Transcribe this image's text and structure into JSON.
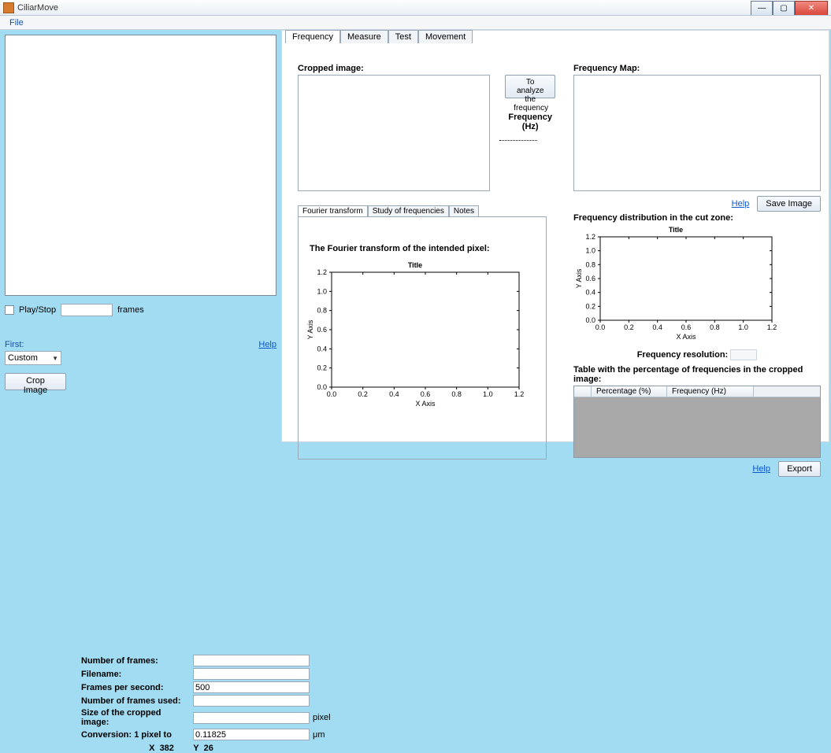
{
  "window": {
    "title": "CiliarMove"
  },
  "menu": {
    "file": "File"
  },
  "winbtns": {
    "min": "—",
    "max": "▢",
    "close": "✕"
  },
  "left": {
    "play_stop": "Play/Stop",
    "frames_suffix": "frames",
    "first_label": "First:",
    "help": "Help",
    "combo_value": "Custom",
    "crop_button": "Crop Image",
    "form": {
      "num_frames_label": "Number of frames:",
      "filename_label": "Filename:",
      "fps_label": "Frames per second:",
      "fps_value": "500",
      "frames_used_label": "Number of frames used:",
      "crop_size_label": "Size of the cropped image:",
      "crop_size_unit": "pixel",
      "conversion_label": "Conversion:   1 pixel to",
      "conversion_value": "0.11825",
      "conversion_unit": "μm"
    },
    "cursor": {
      "x_label": "X",
      "x_val": "382",
      "y_label": "Y",
      "y_val": "26"
    }
  },
  "tabs": {
    "frequency": "Frequency",
    "measure": "Measure",
    "test": "Test",
    "movement": "Movement"
  },
  "freq_tab": {
    "cropped_label": "Cropped image:",
    "analyze_btn": "To analyze the frequency",
    "freq_hz_label": "Frequency (Hz)",
    "fmap_label": "Frequency Map:",
    "save_image": "Save Image",
    "dist_label": "Frequency distribution in the cut zone:",
    "freq_res_label": "Frequency resolution:",
    "table_label": "Table with the percentage of frequencies in the cropped image:",
    "table_cols": {
      "pct": "Percentage (%)",
      "hz": "Frequency (Hz)"
    },
    "export": "Export",
    "help": "Help"
  },
  "sub_tabs": {
    "fourier": "Fourier transform",
    "study": "Study of frequencies",
    "notes": "Notes"
  },
  "fourier": {
    "heading": "The Fourier transform of the intended pixel:"
  },
  "chart_data": [
    {
      "id": "fourier_chart",
      "type": "line",
      "title": "Title",
      "xlabel": "X Axis",
      "ylabel": "Y Axis",
      "xlim": [
        0.0,
        1.2
      ],
      "ylim": [
        0.0,
        1.2
      ],
      "xticks": [
        0.0,
        0.2,
        0.4,
        0.6,
        0.8,
        1.0,
        1.2
      ],
      "yticks": [
        0.0,
        0.2,
        0.4,
        0.6,
        0.8,
        1.0,
        1.2
      ],
      "series": []
    },
    {
      "id": "dist_chart",
      "type": "line",
      "title": "Title",
      "xlabel": "X Axis",
      "ylabel": "Y Axis",
      "xlim": [
        0.0,
        1.2
      ],
      "ylim": [
        0.0,
        1.2
      ],
      "xticks": [
        0.0,
        0.2,
        0.4,
        0.6,
        0.8,
        1.0,
        1.2
      ],
      "yticks": [
        0.0,
        0.2,
        0.4,
        0.6,
        0.8,
        1.0,
        1.2
      ],
      "series": []
    }
  ]
}
